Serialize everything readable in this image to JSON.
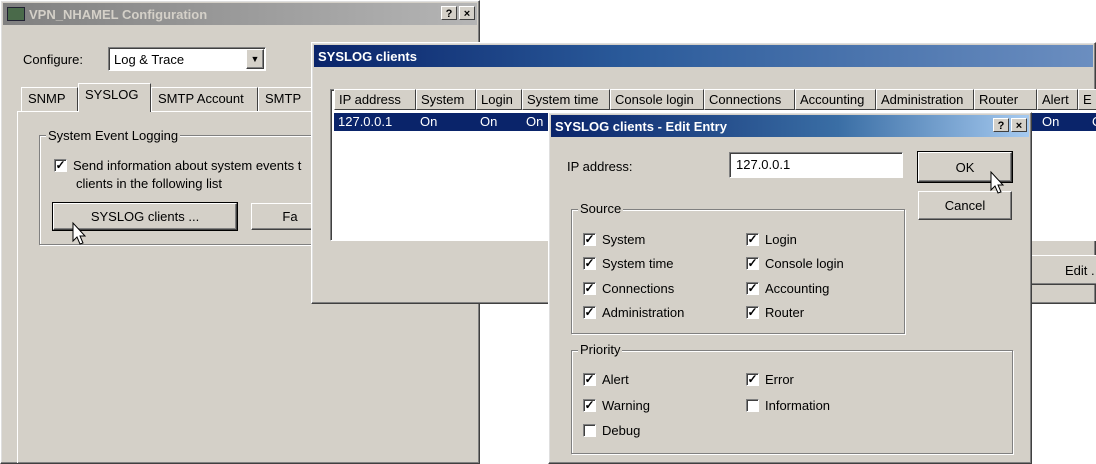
{
  "config_window": {
    "title": "VPN_NHAMEL Configuration",
    "configure_label": "Configure:",
    "configure_value": "Log & Trace",
    "tabs": [
      "SNMP",
      "SYSLOG",
      "SMTP Account",
      "SMTP"
    ],
    "group_title": "System Event Logging",
    "send_info_text_1": "Send information about system events t",
    "send_info_text_2": "clients in the following list",
    "syslog_clients_button": "SYSLOG clients ...",
    "partial_button": "Fa"
  },
  "syslog_window": {
    "title": "SYSLOG clients",
    "columns": [
      "IP address",
      "System",
      "Login",
      "System time",
      "Console login",
      "Connections",
      "Accounting",
      "Administration",
      "Router",
      "Alert",
      "E"
    ],
    "row": [
      "127.0.0.1",
      "On",
      "On",
      "On",
      "On",
      "On"
    ],
    "edit_button": "Edit ."
  },
  "edit_dialog": {
    "title": "SYSLOG clients - Edit Entry",
    "ip_label": "IP address:",
    "ip_value": "127.0.0.1",
    "ok_label": "OK",
    "cancel_label": "Cancel",
    "source_title": "Source",
    "source": [
      {
        "label": "System",
        "checked": true
      },
      {
        "label": "Login",
        "checked": true
      },
      {
        "label": "System time",
        "checked": true
      },
      {
        "label": "Console login",
        "checked": true
      },
      {
        "label": "Connections",
        "checked": true
      },
      {
        "label": "Accounting",
        "checked": true
      },
      {
        "label": "Administration",
        "checked": true
      },
      {
        "label": "Router",
        "checked": true
      }
    ],
    "priority_title": "Priority",
    "priority": [
      {
        "label": "Alert",
        "checked": true
      },
      {
        "label": "Error",
        "checked": true
      },
      {
        "label": "Warning",
        "checked": true
      },
      {
        "label": "Information",
        "checked": false
      },
      {
        "label": "Debug",
        "checked": false
      }
    ]
  },
  "titlebar_buttons": {
    "help": "?",
    "close": "×"
  }
}
